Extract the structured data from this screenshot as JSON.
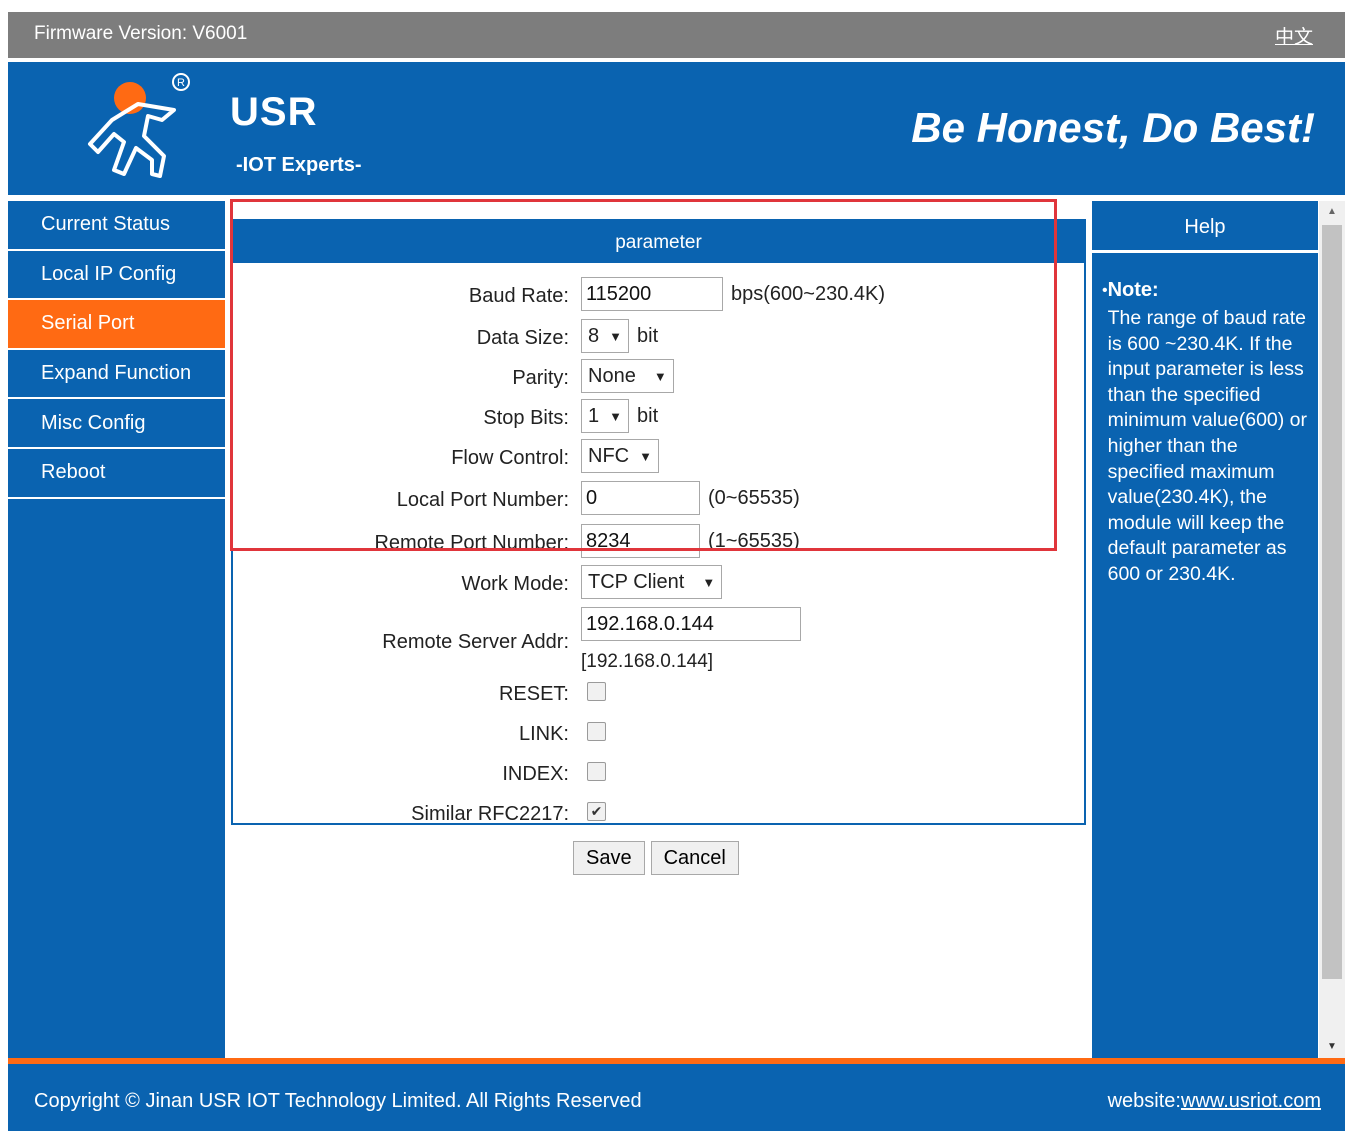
{
  "topbar": {
    "firmware": "Firmware Version: V6001",
    "language_link": "中文"
  },
  "header": {
    "brand": "USR",
    "brand_sub": "-IOT Experts-",
    "slogan": "Be Honest, Do Best!",
    "logo_icon": "usr-runner-logo",
    "registered_mark": "®"
  },
  "sidebar": {
    "items": [
      {
        "label": "Current Status"
      },
      {
        "label": "Local IP Config"
      },
      {
        "label": "Serial Port"
      },
      {
        "label": "Expand Function"
      },
      {
        "label": "Misc Config"
      },
      {
        "label": "Reboot"
      }
    ],
    "active_index": 2
  },
  "panel": {
    "title": "parameter",
    "baud_rate": {
      "label": "Baud Rate:",
      "value": "115200",
      "unit": "bps(600~230.4K)"
    },
    "data_size": {
      "label": "Data Size:",
      "value": "8",
      "unit": "bit"
    },
    "parity": {
      "label": "Parity:",
      "value": "None"
    },
    "stop_bits": {
      "label": "Stop Bits:",
      "value": "1",
      "unit": "bit"
    },
    "flow_control": {
      "label": "Flow Control:",
      "value": "NFC"
    },
    "local_port": {
      "label": "Local Port Number:",
      "value": "0",
      "range": "(0~65535)"
    },
    "remote_port": {
      "label": "Remote Port Number:",
      "value": "8234",
      "range": "(1~65535)"
    },
    "work_mode": {
      "label": "Work Mode:",
      "value": "TCP Client"
    },
    "remote_server": {
      "label": "Remote Server Addr:",
      "value": "192.168.0.144",
      "resolved": "[192.168.0.144]"
    },
    "reset": {
      "label": "RESET:",
      "checked": false
    },
    "link": {
      "label": "LINK:",
      "checked": false
    },
    "index": {
      "label": "INDEX:",
      "checked": false
    },
    "rfc2217": {
      "label": "Similar RFC2217:",
      "checked": true,
      "mark": "✔"
    }
  },
  "buttons": {
    "save": "Save",
    "cancel": "Cancel"
  },
  "help": {
    "title": "Help",
    "bullet": "•",
    "note_title": "Note:",
    "note_text": "The range of baud rate is 600 ~230.4K. If the input parameter is less than the specified minimum value(600) or higher than the specified maximum value(230.4K), the module will keep the default parameter as 600 or 230.4K."
  },
  "scrollbar": {
    "up_arrow": "▲",
    "down_arrow": "▼"
  },
  "footer": {
    "copyright": "Copyright © Jinan USR IOT Technology Limited. All Rights Reserved",
    "website_label": "website:",
    "website_url": "www.usriot.com"
  },
  "colors": {
    "brand_blue": "#0a63b0",
    "accent_orange": "#ff6a13",
    "topbar_gray": "#7d7d7d",
    "highlight_red": "#e0353b"
  }
}
